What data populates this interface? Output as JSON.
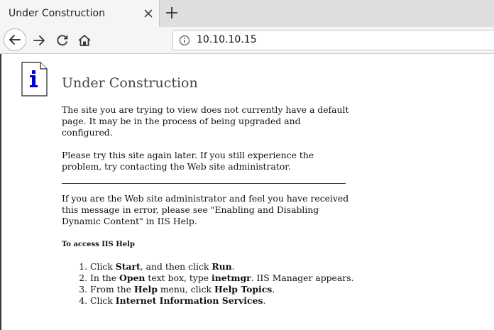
{
  "browser": {
    "tab_title": "Under Construction",
    "url": "10.10.10.15"
  },
  "page": {
    "title": "Under Construction",
    "para1": "The site you are trying to view does not currently have a default page. It may be in the process of being upgraded and configured.",
    "para2": "Please try this site again later. If you still experience the problem, try contacting the Web site administrator.",
    "para3": "If you are the Web site administrator and feel you have received this message in error, please see \"Enabling and Disabling Dynamic Content\" in IIS Help.",
    "help_heading": "To access IIS Help",
    "steps": [
      {
        "pre": "Click ",
        "b1": "Start",
        "mid": ", and then click ",
        "b2": "Run",
        "post": "."
      },
      {
        "pre": "In the ",
        "b1": "Open",
        "mid": " text box, type ",
        "b2": "inetmgr",
        "post": ". IIS Manager appears."
      },
      {
        "pre": "From the ",
        "b1": "Help",
        "mid": " menu, click ",
        "b2": "Help Topics",
        "post": "."
      },
      {
        "pre": "Click ",
        "b1": "Internet Information Services",
        "mid": "",
        "b2": "",
        "post": "."
      }
    ]
  },
  "colors": {
    "icon_blue": "#0000cc",
    "tab_bg": "#f5f5f5",
    "tabbar_bg": "#dedede"
  },
  "icons": [
    "close-icon",
    "plus-icon",
    "back-arrow-icon",
    "forward-arrow-icon",
    "reload-icon",
    "home-icon",
    "info-icon",
    "document-info-icon"
  ]
}
